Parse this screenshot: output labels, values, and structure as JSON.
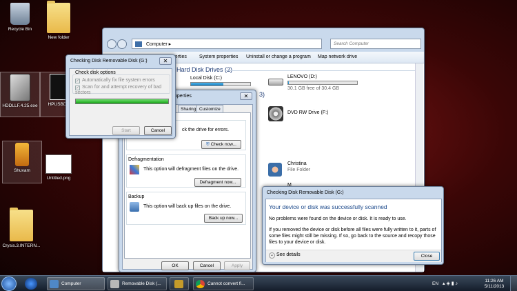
{
  "desktop": {
    "icons": [
      {
        "label": "Recycle Bin"
      },
      {
        "label": "New folder"
      },
      {
        "label": "HDDLLF.4.25.exe"
      },
      {
        "label": "HPUSBDisk"
      },
      {
        "label": "Shuvam"
      },
      {
        "label": "Untitled.png"
      },
      {
        "label": "Crysis.3.INTERN..."
      }
    ]
  },
  "explorer": {
    "address": "Computer",
    "search_placeholder": "Search Computer",
    "toolbar": [
      "Properties",
      "System properties",
      "Uninstall or change a program",
      "Map network drive"
    ],
    "section_title": "Hard Disk Drives (2)",
    "section_fragment": "3)",
    "drives": [
      {
        "name": "Local Disk (C:)",
        "fill": 0.55
      },
      {
        "name": "LENOVO (D:)",
        "free": "30.1 GB free of 30.4 GB",
        "fill": 0.01
      }
    ],
    "dvd": "DVD RW Drive (F:)",
    "folder": {
      "name": "Christina",
      "type": "File Folder"
    },
    "more_partial": "M"
  },
  "check_dialog": {
    "title": "Checking Disk Removable Disk (G:)",
    "group": "Check disk options",
    "opt1": "Automatically fix file system errors",
    "opt2": "Scan for and attempt recovery of bad sectors",
    "progress": 1.0,
    "start": "Start",
    "cancel": "Cancel"
  },
  "props": {
    "title": "operties",
    "tabs": [
      "Sharing",
      "Customize"
    ],
    "errorcheck_text": "ck the drive for errors.",
    "check_now": "Check now...",
    "defrag_title": "Defragmentation",
    "defrag_text": "This option will defragment files on the drive.",
    "defrag_btn": "Defragment now...",
    "backup_title": "Backup",
    "backup_text": "This option will back up files on the drive.",
    "backup_btn": "Back up now...",
    "ok": "OK",
    "cancel": "Cancel",
    "apply": "Apply"
  },
  "result": {
    "title": "Checking Disk Removable Disk (G:)",
    "heading": "Your device or disk was successfully scanned",
    "line1": "No problems were found on the device or disk. It is ready to use.",
    "line2": "If you removed the device or disk before all files were fully written to it, parts of some files might still be missing. If so, go back to the source and recopy those files to your device or disk.",
    "details": "See details",
    "close": "Close"
  },
  "taskbar": {
    "buttons": [
      "Computer",
      "Removable Disk (...",
      "",
      "Cannot convert fi..."
    ],
    "lang": "EN",
    "time": "11:26 AM",
    "date": "5/11/2013"
  },
  "colors": {
    "accent": "#1c82c4",
    "heading": "#1e4b8c",
    "taskbar": "#1a2a3a"
  }
}
